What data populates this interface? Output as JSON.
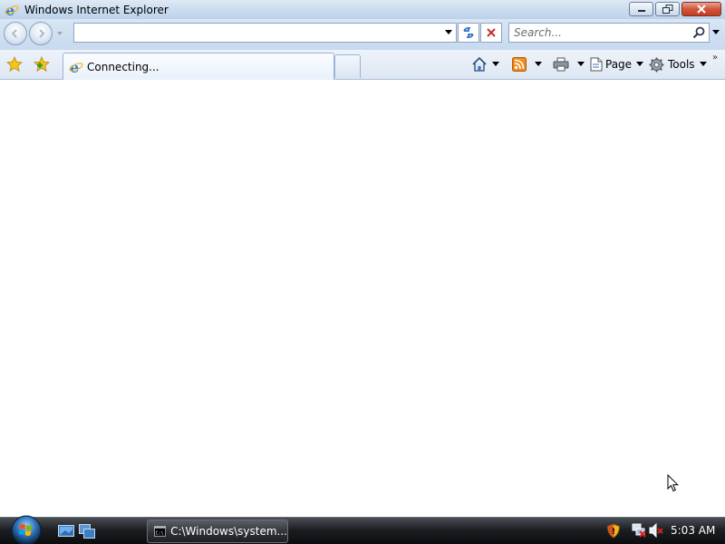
{
  "window": {
    "title": "Windows Internet Explorer"
  },
  "nav": {
    "address_value": "",
    "search_placeholder": "Search..."
  },
  "tab": {
    "label": "Connecting..."
  },
  "commands": {
    "page_label": "Page",
    "tools_label": "Tools"
  },
  "taskbar": {
    "task_label": "C:\\Windows\\system...",
    "clock": "5:03 AM"
  },
  "colors": {
    "titlebar": "#c9dbef",
    "close_button": "#d2543a",
    "taskbar": "#1c1f23",
    "ie_logo": "#2a7fd6"
  },
  "icons": [
    "ie-logo-icon",
    "minimize-icon",
    "restore-icon",
    "close-icon",
    "back-arrow-icon",
    "forward-arrow-icon",
    "refresh-icon",
    "stop-icon",
    "search-magnifier-icon",
    "favorites-star-icon",
    "add-favorites-icon",
    "home-icon",
    "rss-feed-icon",
    "print-icon",
    "page-icon",
    "tools-gear-icon",
    "windows-start-orb-icon",
    "show-desktop-icon",
    "switch-windows-icon",
    "command-prompt-icon",
    "security-shield-icon",
    "network-icon",
    "volume-muted-icon",
    "mouse-cursor-icon"
  ]
}
